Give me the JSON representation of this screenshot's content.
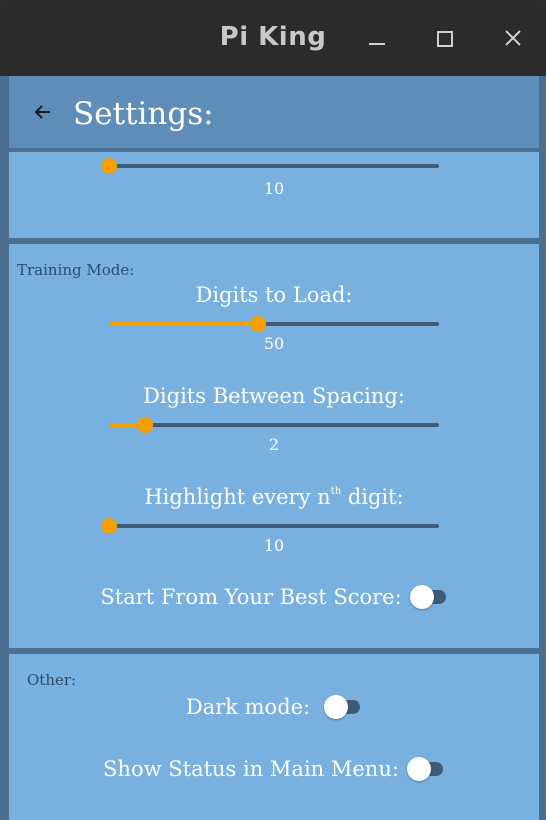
{
  "window": {
    "title": "Pi King"
  },
  "appbar": {
    "title": "Settings:"
  },
  "top_card": {
    "slider": {
      "value_text": "10",
      "fraction": 0.0
    }
  },
  "training": {
    "section_label": "Training Mode:",
    "digits_to_load": {
      "label": "Digits to Load:",
      "value_text": "50",
      "fraction": 0.45
    },
    "digits_between_spacing": {
      "label": "Digits Between Spacing:",
      "value_text": "2",
      "fraction": 0.11
    },
    "highlight": {
      "label_pre": "Highlight every n",
      "label_sup": "th",
      "label_post": " digit:",
      "value_text": "10",
      "fraction": 0.0
    },
    "start_best": {
      "label": "Start From Your Best Score:",
      "on": false
    }
  },
  "other": {
    "section_label": "Other:",
    "dark_mode": {
      "label": "Dark mode:",
      "on": false
    },
    "show_status": {
      "label": "Show Status in Main Menu:",
      "on": false
    }
  },
  "colors": {
    "accent": "#f5a000",
    "card": "#78b0e0",
    "appbar": "#5e8db8",
    "background": "#4c6e8f"
  }
}
